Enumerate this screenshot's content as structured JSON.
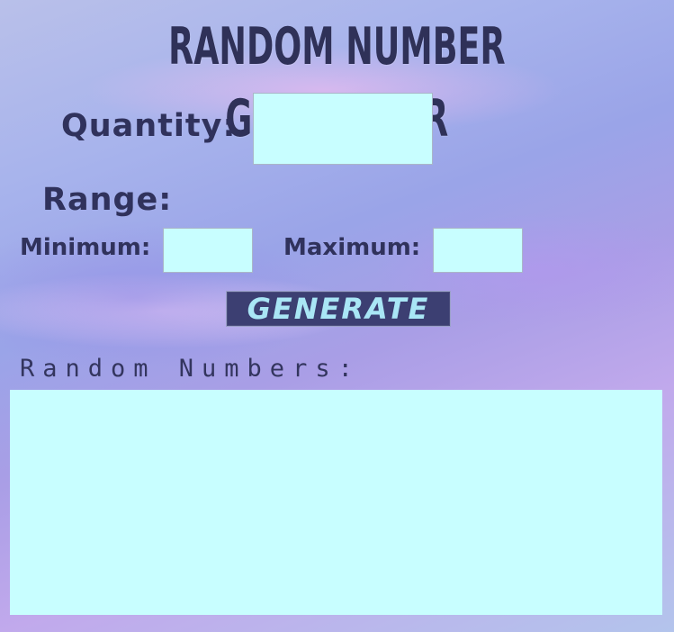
{
  "app": {
    "title": "RANDOM NUMBER GENERATOR"
  },
  "form": {
    "quantity_label": "Quantity:",
    "quantity_value": "",
    "range_label": "Range:",
    "minimum_label": "Minimum:",
    "minimum_value": "",
    "maximum_label": "Maximum:",
    "maximum_value": "",
    "generate_label": "GENERATE"
  },
  "results": {
    "label": "Random Numbers:",
    "value": ""
  },
  "colors": {
    "field_background": "#c8feff",
    "text": "#30325c",
    "button_background": "#3c3f72",
    "button_text": "#a9e6f5"
  }
}
